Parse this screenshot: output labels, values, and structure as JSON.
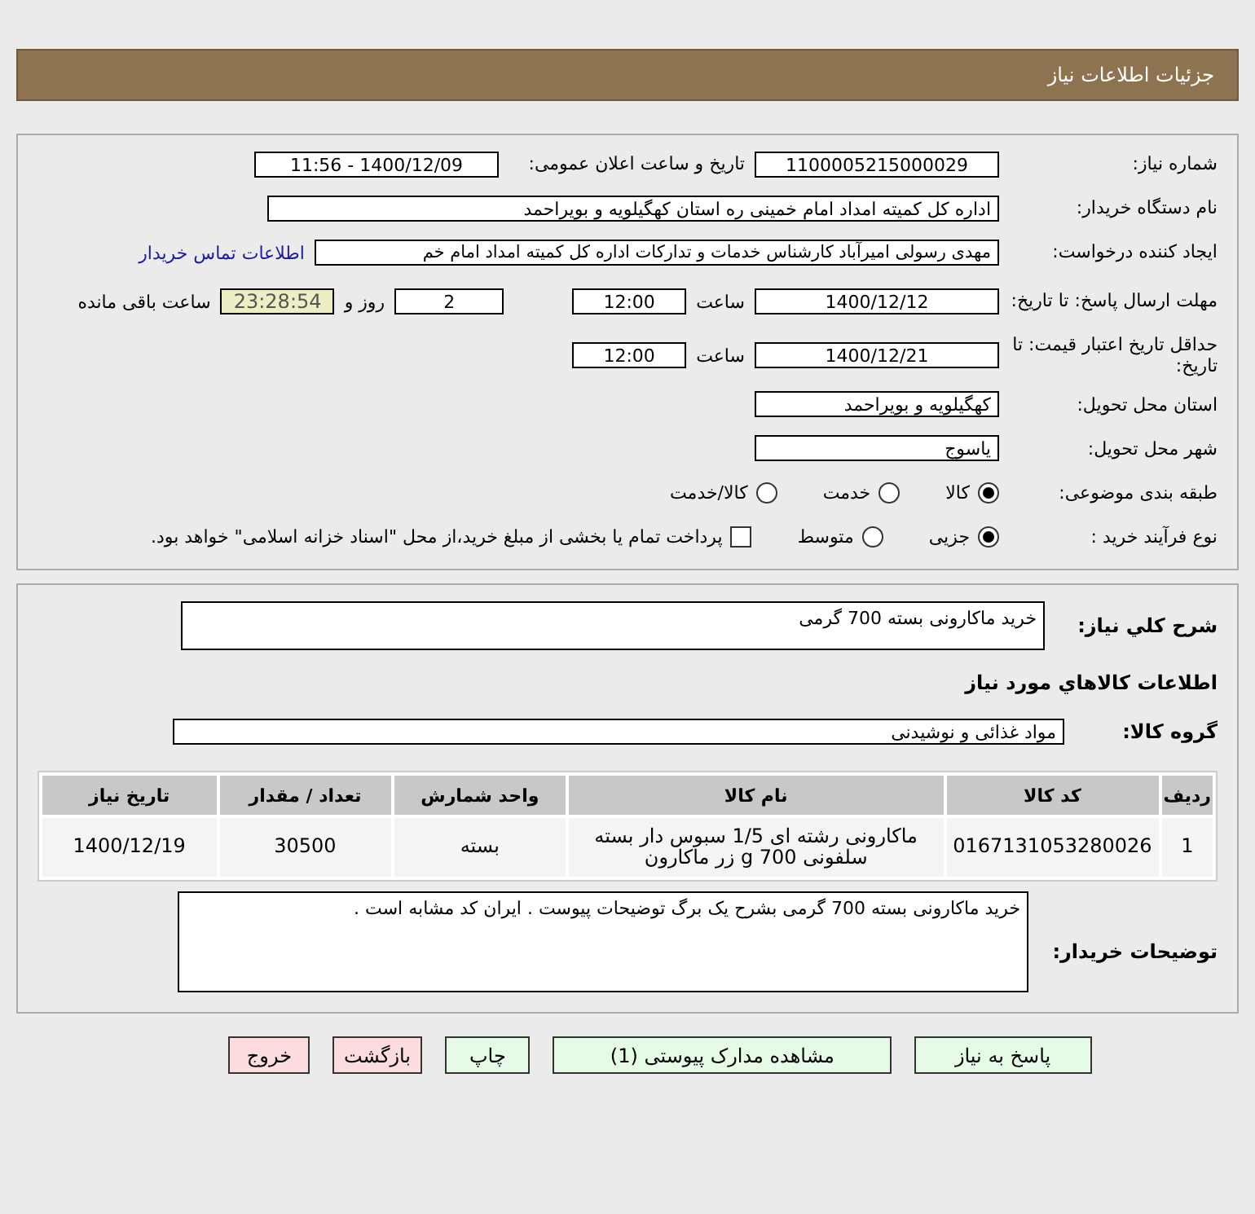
{
  "header": {
    "title": "جزئیات اطلاعات نیاز"
  },
  "details": {
    "need_number": {
      "label": "شماره نیاز:",
      "value": "1100005215000029"
    },
    "announce": {
      "label": "تاریخ و ساعت اعلان عمومی:",
      "value": "1400/12/09 - 11:56"
    },
    "buyer": {
      "label": "نام دستگاه خریدار:",
      "value": "اداره کل کمیته امداد امام خمینی  ره  استان کهگیلویه و بویراحمد"
    },
    "requester": {
      "label": "ایجاد کننده درخواست:",
      "value": "مهدی رسولی امیرآباد کارشناس خدمات و تدارکات اداره کل کمیته امداد امام خم",
      "link": "اطلاعات تماس خریدار"
    },
    "reply_deadline": {
      "label": "مهلت ارسال پاسخ: تا تاریخ:",
      "date": "1400/12/12",
      "time_label": "ساعت",
      "time": "12:00",
      "days": "2",
      "days_label": "روز و",
      "remaining": "23:28:54",
      "remaining_label": "ساعت باقی مانده"
    },
    "price_validity": {
      "label": "حداقل تاریخ اعتبار قیمت: تا تاریخ:",
      "date": "1400/12/21",
      "time_label": "ساعت",
      "time": "12:00"
    },
    "province": {
      "label": "استان محل تحویل:",
      "value": "کهگیلویه و بویراحمد"
    },
    "city": {
      "label": "شهر محل تحویل:",
      "value": "یاسوج"
    },
    "category": {
      "label": "طبقه بندی موضوعی:",
      "options": [
        {
          "label": "کالا",
          "selected": true
        },
        {
          "label": "خدمت",
          "selected": false
        },
        {
          "label": "کالا/خدمت",
          "selected": false
        }
      ]
    },
    "process": {
      "label": "نوع فرآیند خرید :",
      "options": [
        {
          "label": "جزیی",
          "selected": true
        },
        {
          "label": "متوسط",
          "selected": false
        }
      ],
      "treasury": {
        "label": "پرداخت تمام یا بخشی از مبلغ خرید،از محل \"اسناد خزانه اسلامی\" خواهد بود.",
        "checked": false
      }
    }
  },
  "description": {
    "label": "شرح كلي نياز:",
    "value": "خرید ماکارونی بسته 700 گرمی"
  },
  "goods_heading": "اطلاعات كالاهاي مورد نياز",
  "goods_group": {
    "label": "گروه کالا:",
    "value": "مواد غذائی و نوشیدنی"
  },
  "table": {
    "columns": [
      "ردیف",
      "کد کالا",
      "نام کالا",
      "واحد شمارش",
      "تعداد / مقدار",
      "تاریخ نیاز"
    ],
    "rows": [
      [
        "1",
        "0167131053280026",
        "ماکارونی رشته ای 1/5 سبوس دار بسته سلفونی 700 g زر ماکارون",
        "بسته",
        "30500",
        "1400/12/19"
      ]
    ]
  },
  "notes": {
    "label": "توضیحات خریدار:",
    "value": "خرید ماکارونی بسته 700 گرمی بشرح یک برگ توضیحات پیوست . ایران کد مشابه است ."
  },
  "buttons": [
    {
      "label": "پاسخ به نیاز",
      "kind": "primary"
    },
    {
      "label": "مشاهده مدارک پیوستی (1)",
      "kind": "primary"
    },
    {
      "label": "چاپ",
      "kind": "primary"
    },
    {
      "label": "بازگشت",
      "kind": "danger"
    },
    {
      "label": "خروج",
      "kind": "danger"
    }
  ]
}
